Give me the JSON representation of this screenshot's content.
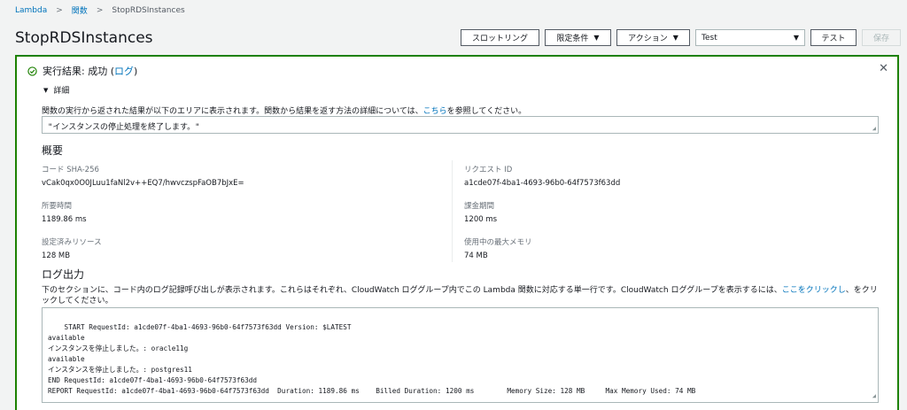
{
  "breadcrumb": {
    "root": "Lambda",
    "functions": "関数",
    "current": "StopRDSInstances"
  },
  "page": {
    "title": "StopRDSInstances"
  },
  "toolbar": {
    "throttle": "スロットリング",
    "qualifiers": "限定条件",
    "actions": "アクション",
    "test_event": "Test",
    "test": "テスト",
    "save": "保存"
  },
  "result": {
    "status_prefix": "実行結果: 成功 (",
    "log_link": "ログ",
    "status_suffix": ")",
    "details": "詳細",
    "desc_prefix": "関数の実行から返された結果が以下のエリアに表示されます。関数から結果を返す方法の詳細については、",
    "desc_link": "こちら",
    "desc_suffix": "を参照してください。",
    "value": "\"インスタンスの停止処理を終了します。\""
  },
  "summary": {
    "heading": "概要",
    "code_sha_label": "コード SHA-256",
    "code_sha": "vCak0qx0O0JLuu1faNl2v++EQ7/hwvczspFaOB7bJxE=",
    "request_id_label": "リクエスト ID",
    "request_id": "a1cde07f-4ba1-4693-96b0-64f7573f63dd",
    "duration_label": "所要時間",
    "duration": "1189.86 ms",
    "billed_label": "課金期間",
    "billed": "1200 ms",
    "resources_label": "設定済みリソース",
    "resources": "128 MB",
    "max_mem_label": "使用中の最大メモリ",
    "max_mem": "74 MB"
  },
  "log": {
    "heading": "ログ出力",
    "desc_prefix": "下のセクションに、コード内のログ記録呼び出しが表示されます。これらはそれぞれ、CloudWatch ロググループ内でこの Lambda 関数に対応する単一行です。CloudWatch ロググループを表示するには、",
    "desc_link": "ここをクリックし",
    "desc_suffix": "、をクリックしてください。",
    "lines": "START RequestId: a1cde07f-4ba1-4693-96b0-64f7573f63dd Version: $LATEST\navailable\nインスタンスを停止しました。: oracle11g\navailable\nインスタンスを停止しました。: postgres11\nEND RequestId: a1cde07f-4ba1-4693-96b0-64f7573f63dd\nREPORT RequestId: a1cde07f-4ba1-4693-96b0-64f7573f63dd  Duration: 1189.86 ms    Billed Duration: 1200 ms        Memory Size: 128 MB     Max Memory Used: 74 MB"
  },
  "colors": {
    "success": "#1d8102",
    "link": "#0073bb"
  }
}
